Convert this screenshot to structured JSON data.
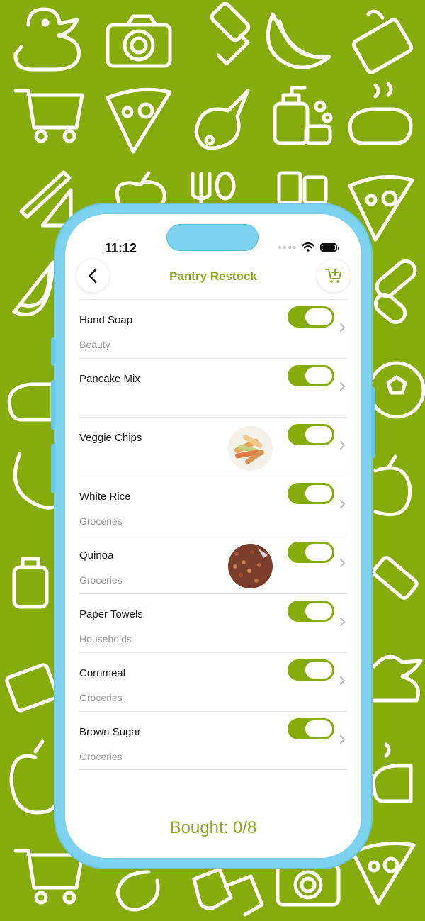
{
  "status_bar": {
    "time": "11:12"
  },
  "nav": {
    "title": "Pantry Restock",
    "back_icon": "chevron-left-icon",
    "cart_icon": "add-to-cart-icon"
  },
  "items": [
    {
      "name": "Hand Soap",
      "category": "Beauty",
      "has_image": false,
      "toggled": true
    },
    {
      "name": "Pancake Mix",
      "category": "",
      "has_image": false,
      "toggled": true
    },
    {
      "name": "Veggie Chips",
      "category": "",
      "has_image": true,
      "image": "veggie-chips-photo",
      "toggled": true
    },
    {
      "name": "White Rice",
      "category": "Groceries",
      "has_image": false,
      "toggled": true
    },
    {
      "name": "Quinoa",
      "category": "Groceries",
      "has_image": true,
      "image": "quinoa-photo",
      "toggled": true
    },
    {
      "name": "Paper Towels",
      "category": "Households",
      "has_image": false,
      "toggled": true
    },
    {
      "name": "Cornmeal",
      "category": "Groceries",
      "has_image": false,
      "toggled": true
    },
    {
      "name": "Brown Sugar",
      "category": "Groceries",
      "has_image": false,
      "toggled": true
    }
  ],
  "footer": {
    "bought_label": "Bought: 0/8"
  },
  "colors": {
    "accent": "#86ac0b",
    "phone_frame": "#7dd3ef",
    "background": "#86ac0b"
  }
}
